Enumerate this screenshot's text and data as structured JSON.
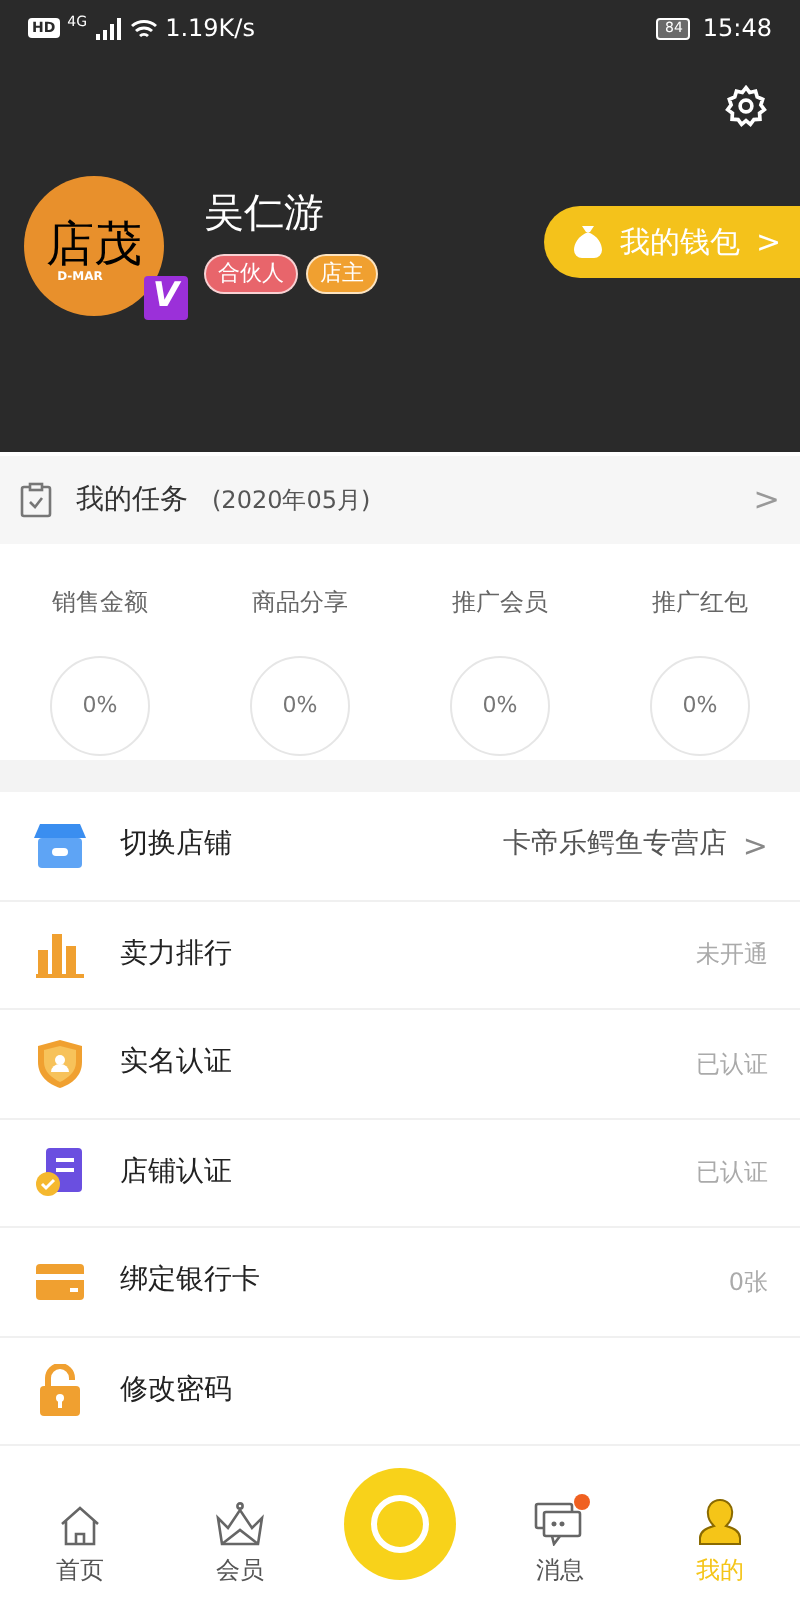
{
  "status_bar": {
    "hd": "HD",
    "network": "4G",
    "speed": "1.19K/s",
    "battery": "84",
    "time": "15:48"
  },
  "profile": {
    "avatar_text": "店茂",
    "avatar_sub": "D-MAR",
    "vip_badge": "V",
    "name": "吴仁游",
    "tags": [
      {
        "label": "合伙人",
        "color": "#e8656b"
      },
      {
        "label": "店主",
        "color": "#f0a030"
      }
    ],
    "wallet_button": "我的钱包",
    "wallet_chevron": ">"
  },
  "tasks": {
    "title": "我的任务",
    "period": "(2020年05月)",
    "chevron": ">",
    "items": [
      {
        "label": "销售金额",
        "value": "0%"
      },
      {
        "label": "商品分享",
        "value": "0%"
      },
      {
        "label": "推广会员",
        "value": "0%"
      },
      {
        "label": "推广红包",
        "value": "0%"
      }
    ]
  },
  "menu": [
    {
      "kind": "store",
      "label": "切换店铺",
      "value": "卡帝乐鳄鱼专营店",
      "chevron": ">"
    },
    {
      "kind": "rank",
      "label": "卖力排行",
      "value": "未开通"
    },
    {
      "kind": "realname",
      "label": "实名认证",
      "value": "已认证"
    },
    {
      "kind": "storecert",
      "label": "店铺认证",
      "value": "已认证"
    },
    {
      "kind": "card",
      "label": "绑定银行卡",
      "value": "0张"
    },
    {
      "kind": "lock",
      "label": "修改密码"
    }
  ],
  "tab_bar": [
    {
      "kind": "home",
      "label": "首页",
      "selected": false,
      "badge": false
    },
    {
      "kind": "crown",
      "label": "会员",
      "selected": false,
      "badge": false
    },
    {
      "kind": "camera",
      "selected": false,
      "badge": false
    },
    {
      "kind": "message",
      "label": "消息",
      "selected": false,
      "badge": true
    },
    {
      "kind": "person",
      "label": "我的",
      "selected": true,
      "badge": false
    }
  ]
}
